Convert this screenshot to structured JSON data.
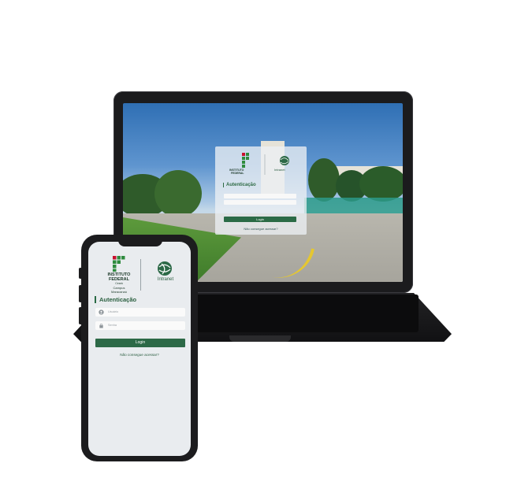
{
  "laptop": {
    "login_card": {
      "logo_text": [
        "INSTITUTO",
        "FEDERAL",
        "Ceará",
        "Campus",
        "Maracanaú"
      ],
      "app_name": "Intranet",
      "title": "Autenticação",
      "login_button": "Login",
      "forgot_link": "Não consegue acessar?"
    }
  },
  "phone": {
    "logo": {
      "line1": "INSTITUTO",
      "line2": "FEDERAL",
      "line3": "Ceará",
      "line4": "Campus",
      "line5": "Maracanaú"
    },
    "app_name": "Intranet",
    "title": "Autenticação",
    "username_placeholder": "Usuário",
    "password_placeholder": "Senha",
    "login_button": "Login",
    "forgot_link": "Não consegue acessar?"
  },
  "colors": {
    "brand_green": "#2c6947",
    "brand_red": "#c8102e",
    "device_body": "#1c1c1e"
  }
}
